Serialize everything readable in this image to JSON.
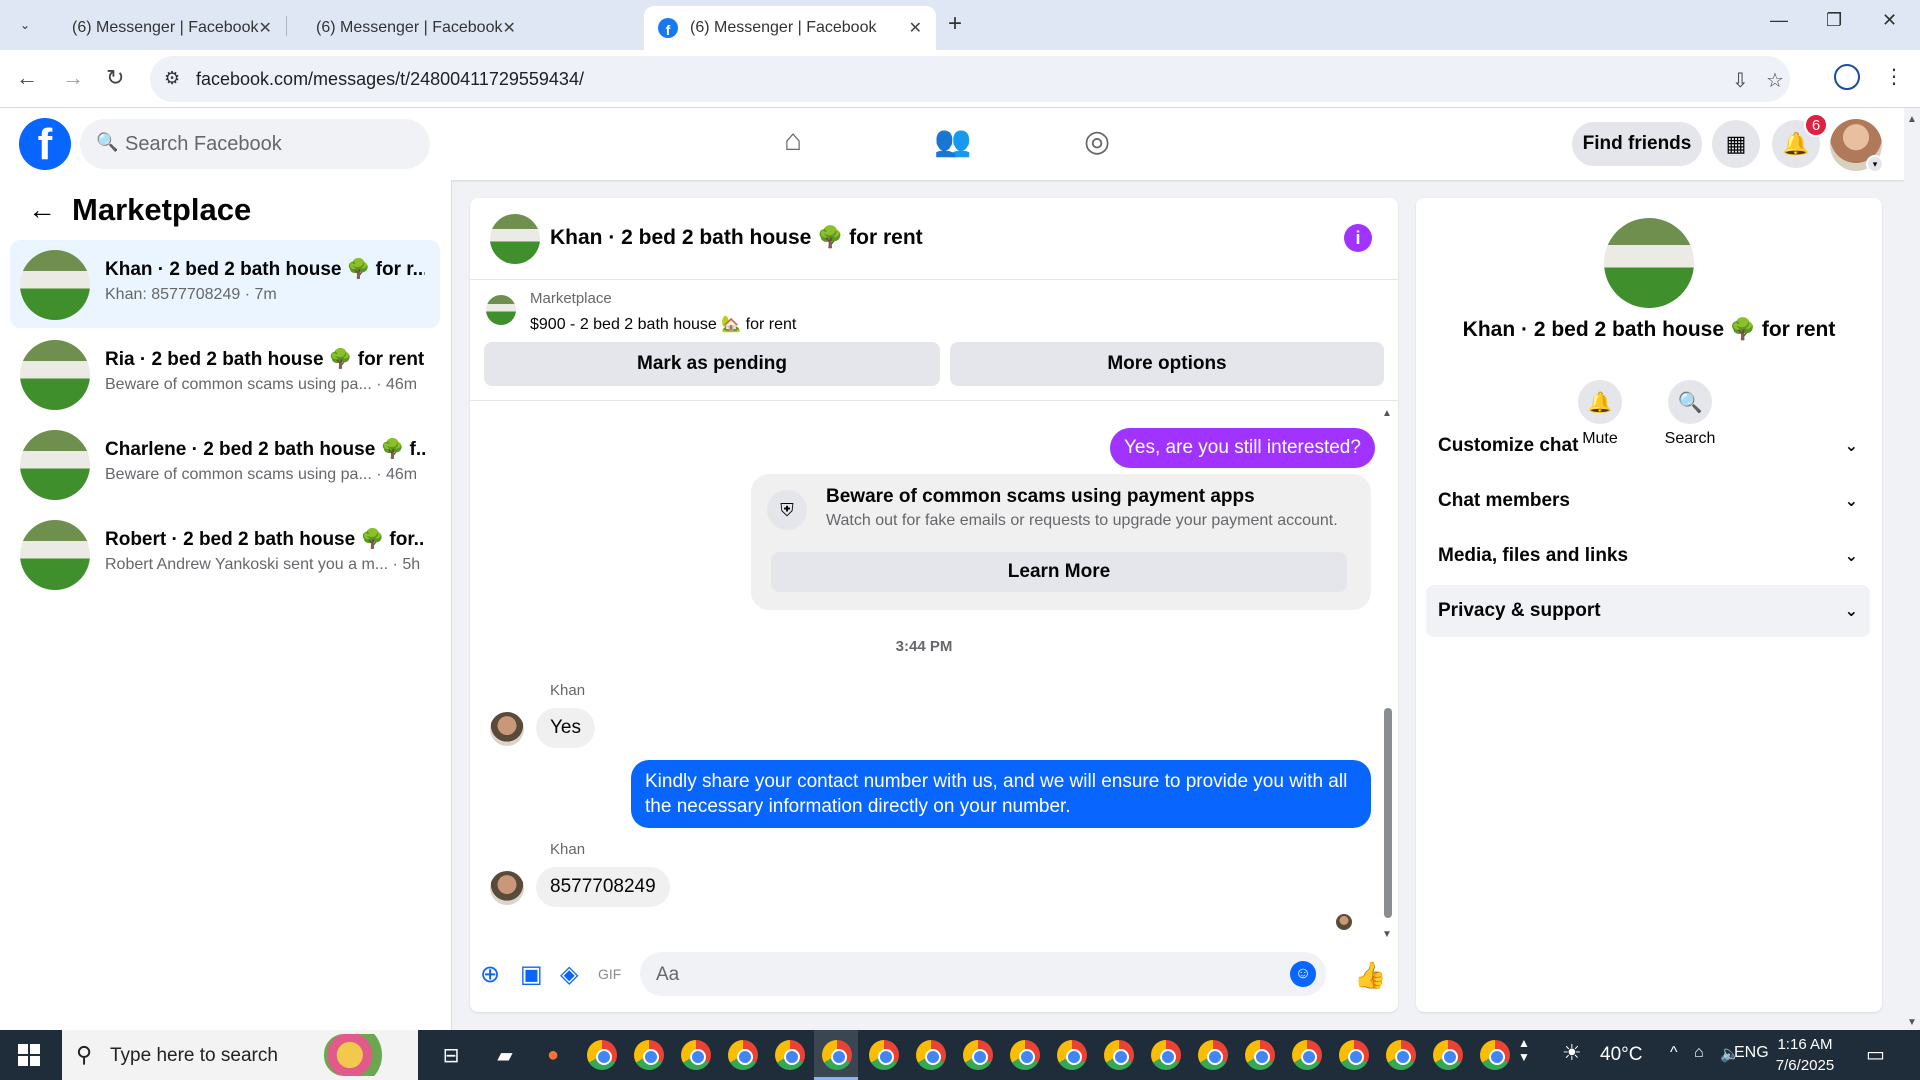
{
  "browser": {
    "tabs": [
      {
        "title": "(6) Messenger | Facebook",
        "active": false
      },
      {
        "title": "(6) Messenger | Facebook",
        "active": false
      },
      {
        "title": "(6) Messenger | Facebook",
        "active": true
      }
    ],
    "url": "facebook.com/messages/t/24800411729559434/"
  },
  "fb_header": {
    "search_placeholder": "Search Facebook",
    "find_friends_label": "Find friends",
    "notification_count": "6"
  },
  "left_panel": {
    "title": "Marketplace",
    "conversations": [
      {
        "name": "Khan · 2 bed 2 bath house 🌳 for r...",
        "preview": "Khan: 8577708249 · 7m",
        "selected": true
      },
      {
        "name": "Ria · 2 bed 2 bath house 🌳 for rent",
        "preview": "Beware of common scams using pa... · 46m",
        "selected": false
      },
      {
        "name": "Charlene · 2 bed 2 bath house 🌳 f...",
        "preview": "Beware of common scams using pa... · 46m",
        "selected": false
      },
      {
        "name": "Robert · 2 bed 2 bath house 🌳 for...",
        "preview": "Robert Andrew Yankoski sent you a m... · 5h",
        "selected": false
      }
    ]
  },
  "chat": {
    "title": "Khan · 2 bed 2 bath house 🌳 for rent",
    "marketplace_label": "Marketplace",
    "listing": "$900 - 2 bed 2 bath house 🏡 for rent",
    "mark_pending_label": "Mark as pending",
    "more_options_label": "More options",
    "msg_outgoing_1": "Yes, are you still interested?",
    "scam_title": "Beware of common scams using payment apps",
    "scam_subtitle": "Watch out for fake emails or requests to upgrade your payment account.",
    "learn_more_label": "Learn More",
    "timestamp": "3:44 PM",
    "sender_1": "Khan",
    "msg_incoming_1": "Yes",
    "msg_outgoing_2_line1": "Kindly share your contact number with us, and we will ensure to provide you with all",
    "msg_outgoing_2_line2": "the necessary information directly on your number.",
    "sender_2": "Khan",
    "msg_incoming_2": "8577708249",
    "composer_placeholder": "Aa"
  },
  "right_panel": {
    "title": "Khan · 2 bed 2 bath house 🌳 for rent",
    "actions": [
      {
        "label": "Mute",
        "icon": "bell-icon"
      },
      {
        "label": "Search",
        "icon": "search-icon"
      }
    ],
    "sections": [
      {
        "label": "Customize chat"
      },
      {
        "label": "Chat members"
      },
      {
        "label": "Media, files and links"
      },
      {
        "label": "Privacy & support"
      }
    ]
  },
  "taskbar": {
    "search_placeholder": "Type here to search",
    "temperature": "40°C",
    "language": "ENG",
    "time": "1:16 AM",
    "date": "7/6/2025"
  },
  "colors": {
    "fb_blue": "#0866ff",
    "purple_bubble": "#a033ff",
    "selected_conv": "#ebf5ff",
    "badge_red": "#e41e3f"
  }
}
